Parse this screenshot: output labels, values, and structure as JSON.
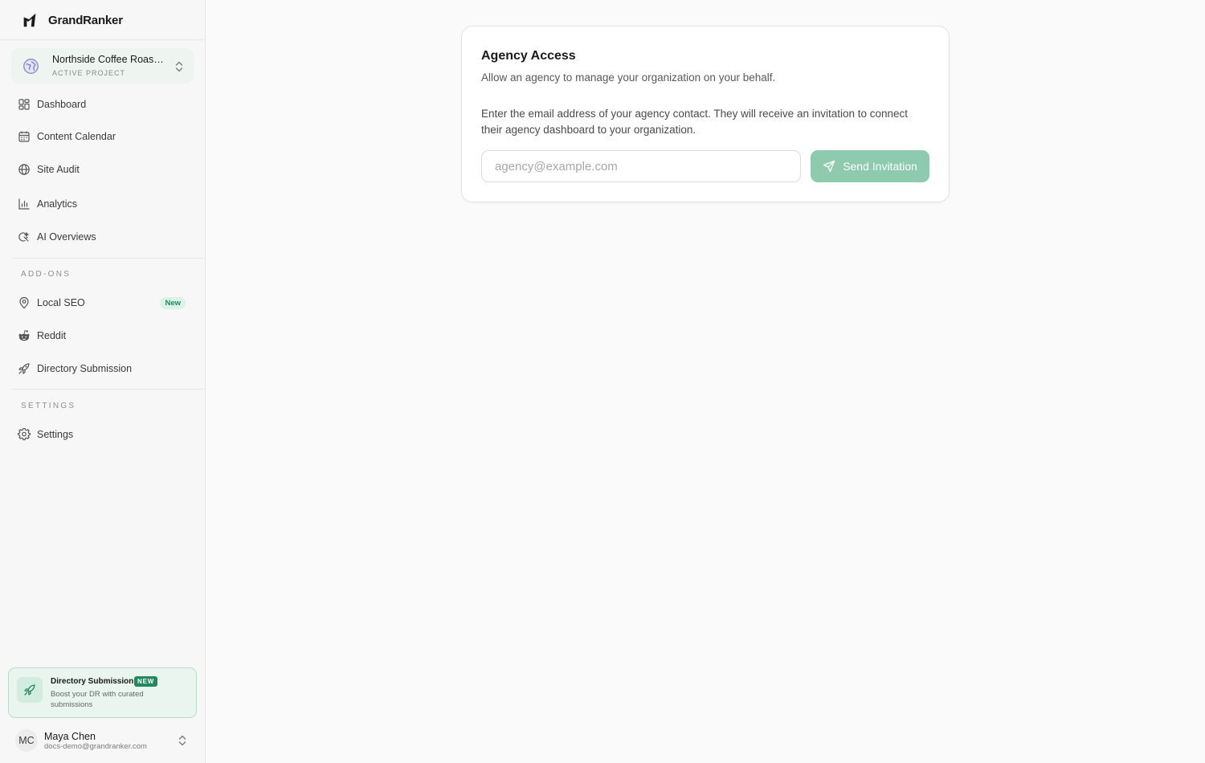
{
  "brand": {
    "name": "GrandRanker",
    "logo_icon": "grandranker-logo-icon"
  },
  "project": {
    "name": "Northside Coffee Roasters",
    "label": "ACTIVE PROJECT",
    "icon": "globe-icon"
  },
  "nav": {
    "items": [
      {
        "label": "Dashboard",
        "icon": "dashboard-grid-icon"
      },
      {
        "label": "Content Calendar",
        "icon": "calendar-icon"
      },
      {
        "label": "Site Audit",
        "icon": "globe-icon"
      },
      {
        "label": "Analytics",
        "icon": "bar-chart-icon"
      },
      {
        "label": "AI Overviews",
        "icon": "ai-sparkle-icon"
      }
    ],
    "addons_label": "ADD-ONS",
    "addons": [
      {
        "label": "Local SEO",
        "icon": "map-pin-icon",
        "badge": "New"
      },
      {
        "label": "Reddit",
        "icon": "reddit-icon"
      },
      {
        "label": "Directory Submission",
        "icon": "rocket-icon"
      }
    ],
    "settings_label": "SETTINGS",
    "settings": [
      {
        "label": "Settings",
        "icon": "gear-icon"
      }
    ]
  },
  "promo": {
    "title": "Directory Submission",
    "badge": "NEW",
    "description": "Boost your DR with curated submissions",
    "icon": "rocket-icon"
  },
  "user": {
    "initials": "MC",
    "name": "Maya Chen",
    "email": "docs-demo@grandranker.com"
  },
  "card": {
    "title": "Agency Access",
    "subtitle": "Allow an agency to manage your organization on your behalf.",
    "body": "Enter the email address of your agency contact. They will receive an invitation to connect their agency dashboard to your organization.",
    "input_value": "",
    "input_placeholder": "agency@example.com",
    "button_label": "Send Invitation",
    "button_icon": "send-icon"
  },
  "colors": {
    "accent": "#1f8a5f",
    "button_bg": "#8ecaae",
    "promo_bg": "#eaf5ef"
  }
}
